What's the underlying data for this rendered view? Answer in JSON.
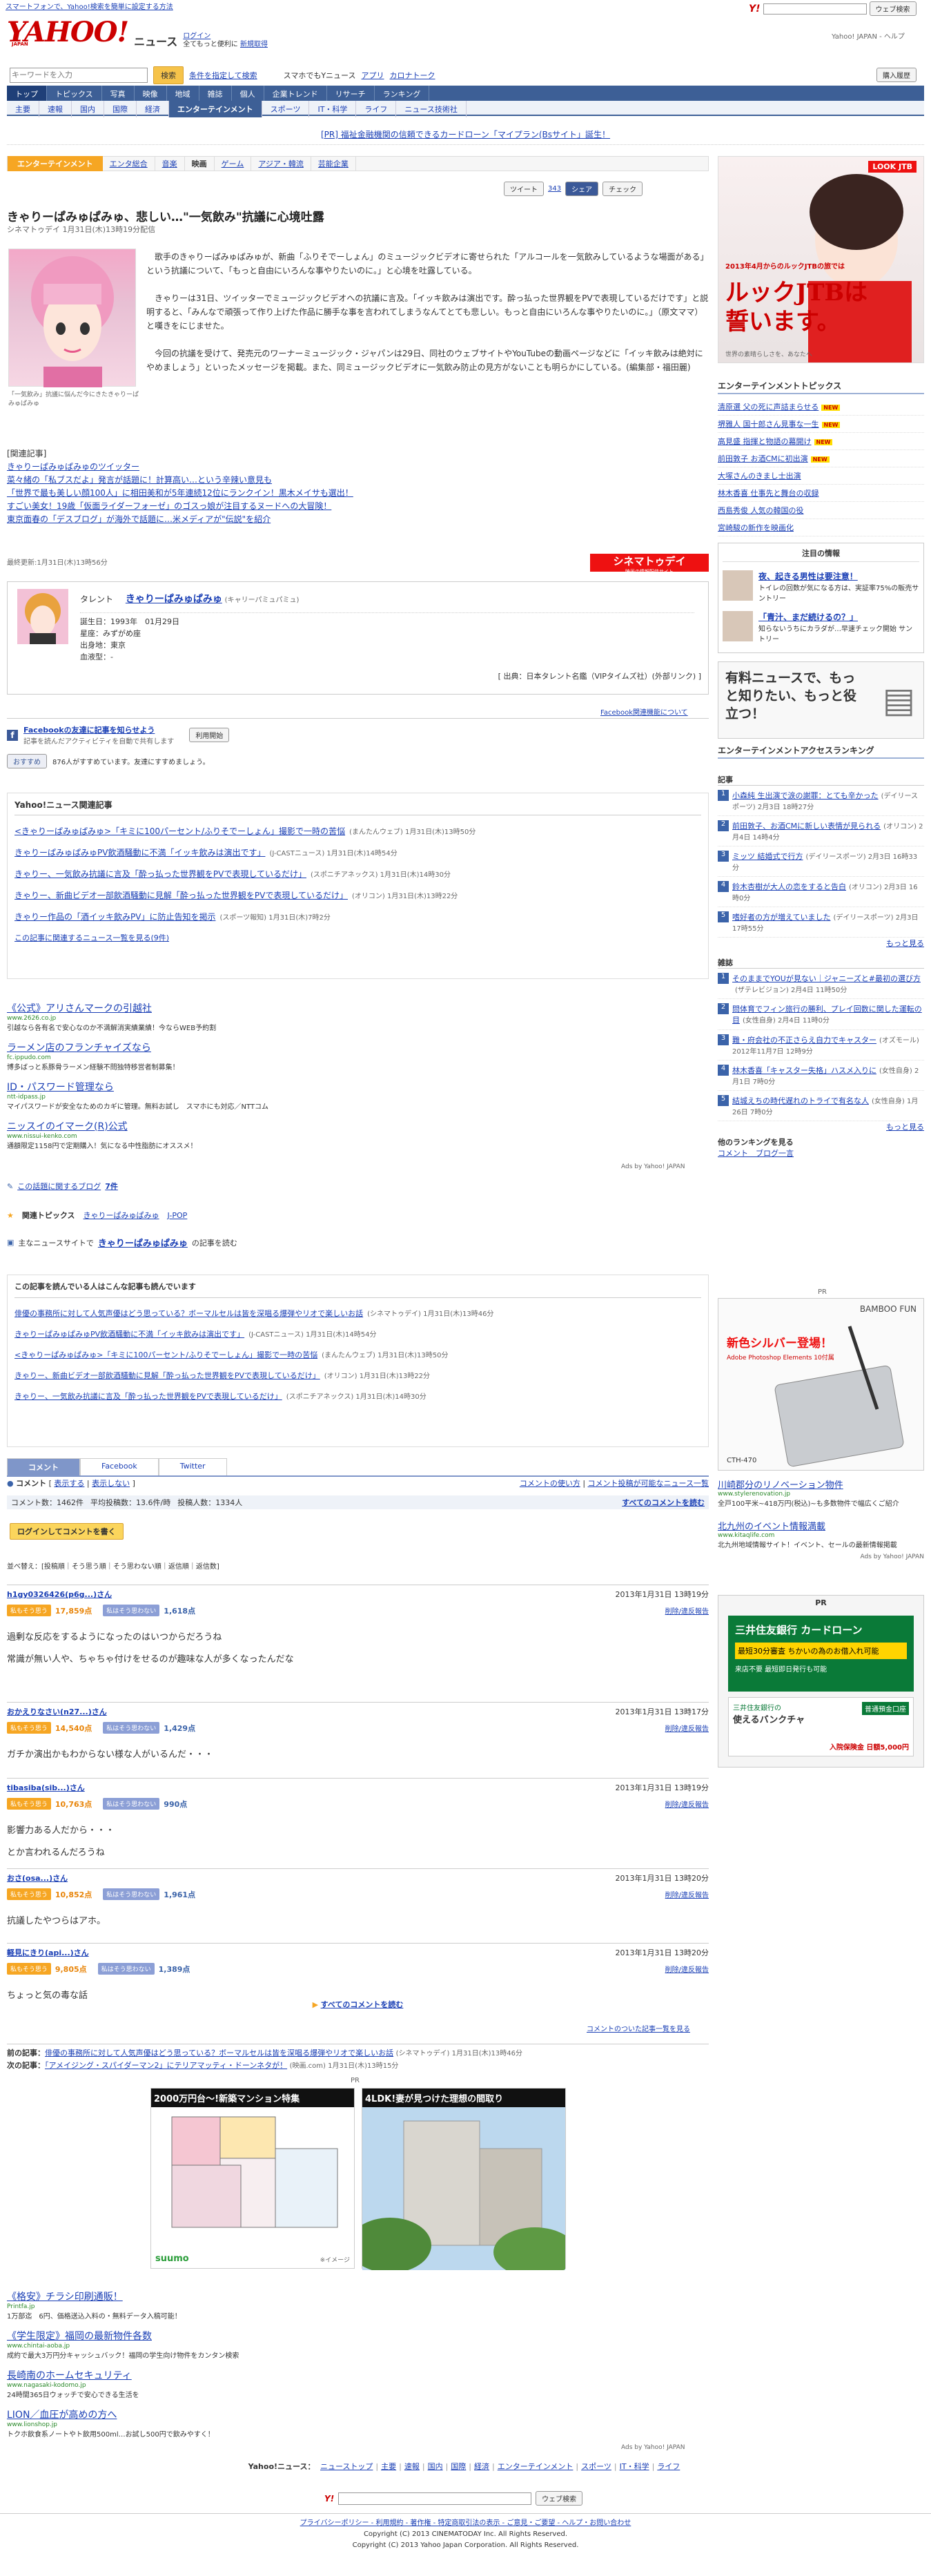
{
  "topbar": {
    "left": "スマートフォンで、Yahoo!検索を簡単に設定する方法",
    "search_btn": "ウェブ検索",
    "links": "Yahoo! JAPAN - ヘルプ"
  },
  "header": {
    "logo": "YAHOO!",
    "logo_sub": "JAPAN",
    "site": "ニュース",
    "login": "ログイン",
    "login_sub": "全てもっと便利に",
    "register": "新規取得",
    "search_placeholder": "キーワードを入力",
    "search_btn": "検索",
    "search_opts": "条件を指定して検索",
    "mobile": "スマホでもYニュース",
    "app": "アプリ",
    "career": "カロナトーク",
    "buy": "購入履歴"
  },
  "tabs": [
    "トップ",
    "トピックス",
    "写真",
    "映像",
    "地域",
    "雑誌",
    "個人",
    "企業トレンド",
    "リサーチ",
    "ランキング"
  ],
  "subnav": [
    "主要",
    "速報",
    "国内",
    "国際",
    "経済",
    "エンターテインメント",
    "スポーツ",
    "IT・科学",
    "ライフ",
    "ニュース技術社"
  ],
  "pr_banner": "[PR] 福祉金融機関の信頼できるカードローン「マイプラン(Bsサイト」誕生！",
  "category": {
    "label": "エンターテインメント",
    "items": [
      "エンタ総合",
      "音楽",
      "映画",
      "ゲーム",
      "アジア・韓流",
      "芸能企業"
    ]
  },
  "article": {
    "title": "きゃりーぱみゅぱみゅ、悲しい…\"一気飲み\"抗議に心境吐露",
    "meta": "シネマトゥデイ 1月31日(木)13時19分配信",
    "tweet": "ツイート",
    "tweet_count": "343",
    "share": "シェア",
    "check": "チェック",
    "photo_caption": "「一気飲み」抗議に悩んだ今にきたきゃりーぱみゅぱみゅ",
    "p1": "歌手のきゃりーぱみゅぱみゅが、新曲「ふりそでーしょん」のミュージックビデオに寄せられた「アルコールを一気飲みしているような場面がある」という抗議について、「もっと自由にいろんな事やりたいのに。」と心境を吐露している。",
    "p2": "きゃりーは31日、ツイッターでミュージックビデオへの抗議に言及。「イッキ飲みは演出です。酔っ払った世界観をPVで表現しているだけです」と説明すると、「みんなで頑張って作り上げた作品に勝手な事を言われてしまうなんてとても悲しい。もっと自由にいろんな事やりたいのに。」（原文ママ）と嘆きをにじませた。",
    "p3": "今回の抗議を受けて、発売元のワーナーミュージック・ジャパンは29日、同社のウェブサイトやYouTubeの動画ページなどに「イッキ飲みは絶対にやめましょう」といったメッセージを掲載。また、同ミュージックビデオに一気飲み防止の見方がないことも明らかにしている。(編集部・福田麗)",
    "related_head": "[関連記事]",
    "related": [
      "きゃりーぱみゅぱみゅのツイッター",
      "菜々緒の「私ブスだよ」発言が話題に！計算高い…という辛辣い意見も",
      "「世界で最も美しい顔100人」に相田美和が5年連続12位にランクイン！黒木メイサも選出！",
      "すごい美女！19歳「仮面ライダーフォーゼ」のゴスっ娘が注目するヌードへの大冒険！",
      "東京面春の「デスブログ」が海外で話題に…米メディアが\"伝説\"を紹介"
    ],
    "updated": "最終更新:1月31日(木)13時56分",
    "cinema_logo": "シネマトゥデイ",
    "cinema_logo_sub": "映画の情報配信サイト"
  },
  "talent": {
    "label": "タレント",
    "name": "きゃりーぱみゅぱみゅ",
    "kana": "(キャリーパミュパミュ)",
    "birth": "誕生日：1993年　01月29日",
    "sign": "星座：みずがめ座",
    "home": "出身地：東京",
    "blood": "血液型：-",
    "source": "[ 出典：日本タレント名鑑（VIPタイムズ社）(外部リンク) ]"
  },
  "fb": {
    "about": "Facebook関連機能について",
    "title": "Facebookの友達に記事を知らせよう",
    "desc": "記事を読んだアクティビティを自動で共有します",
    "start": "利用開始",
    "like_btn": "おすすめ",
    "like_text": "876人がすすめています。友達にすすめましょう。"
  },
  "yrel": {
    "head": "Yahoo!ニュース関連記事",
    "items": [
      {
        "t": "<きゃりーぱみゅぱみゅ>「キミに100パーセント/ふりそでーしょん」撮影で一時の苦悩",
        "s": "(まんたんウェブ) 1月31日(木)13時50分"
      },
      {
        "t": "きゃりーぱみゅぱみゅPV飲酒騒動に不満「イッキ飲みは演出です」",
        "s": "(J-CASTニュース) 1月31日(木)14時54分"
      },
      {
        "t": "きゃりー、一気飲み抗議に言及「酔っ払った世界観をPVで表現しているだけ」",
        "s": "(スポニチアネックス) 1月31日(木)14時30分"
      },
      {
        "t": "きゃりー、新曲ビデオ一部飲酒騒動に見解「酔っ払った世界観をPVで表現しているだけ」",
        "s": "(オリコン) 1月31日(木)13時22分"
      },
      {
        "t": "きゃりー作品の「酒イッキ飲みPV」に防止告知を掲示",
        "s": "(スポーツ報知) 1月31日(木)7時2分"
      }
    ],
    "more": "この記事に関連するニュース一覧を見る(9件)"
  },
  "ads1": [
    {
      "t": "《公式》アリさんマークの引越社",
      "u": "www.2626.co.jp",
      "d": "引越なら各有名で安心なのか不満解消実績業績！今ならWEB予約割"
    },
    {
      "t": "ラーメン店のフランチャイズなら",
      "u": "fc.ippudo.com",
      "d": "博多ばっと系豚骨ラーメン経験不問独特移営者制募集！"
    },
    {
      "t": "ID・パスワード管理なら",
      "u": "ntt-idpass.jp",
      "d": "マイパスワードが安全なためのカギに管理。無料お試し　スマホにも対応／NTTコム"
    },
    {
      "t": "ニッスイのイマーク(R)公式",
      "u": "www.nissui-kenko.com",
      "d": "通額限定1158円で定期購入！気になる中性脂肪にオススメ！"
    }
  ],
  "ads_by": "Ads by Yahoo! JAPAN",
  "blog": {
    "label": "この話題に関するブログ",
    "count": "7件"
  },
  "topics": {
    "label": "関連トピックス",
    "items": [
      "きゃりーぱみゅぱみゅ",
      "J-POP"
    ]
  },
  "mainsite": {
    "label": "主なニュースサイトで",
    "name": "きゃりーぱみゅぱみゅ",
    "suffix": "の記事を読む"
  },
  "alsoread": {
    "head": "この記事を読んでいる人はこんな記事も読んでいます",
    "items": [
      {
        "t": "俳優の事務所に対して人気声優はどう思っている？ボーマルセルは皆を深唱る爆弾やリオで楽しいお話",
        "s": "(シネマトゥデイ) 1月31日(木)13時46分"
      },
      {
        "t": "きゃりーぱみゅぱみゅPV飲酒騒動に不満「イッキ飲みは演出です」",
        "s": "(J-CASTニュース) 1月31日(木)14時54分"
      },
      {
        "t": "<きゃりーぱみゅぱみゅ>「キミに100パーセント/ふりそでーしょん」撮影で一時の苦悩",
        "s": "(まんたんウェブ) 1月31日(木)13時50分"
      },
      {
        "t": "きゃりー、新曲ビデオ一部飲酒騒動に見解「酔っ払った世界観をPVで表現しているだけ」",
        "s": "(オリコン) 1月31日(木)13時22分"
      },
      {
        "t": "きゃりー、一気飲み抗議に言及「酔っ払った世界観をPVで表現しているだけ」",
        "s": "(スポニチアネックス) 1月31日(木)14時30分"
      }
    ]
  },
  "comments": {
    "tabs": [
      "コメント",
      "Facebook",
      "Twitter"
    ],
    "label": "コメント",
    "show": "表示する",
    "hide": "表示しない",
    "tip": "コメントの使い方",
    "listlink": "コメント投稿が可能なニュース一覧",
    "count": "コメント数：1462件",
    "avg": "平均投稿数：13.6件/時",
    "posters": "投稿人数：1334人",
    "all": "すべてのコメントを読む",
    "login": "ログインしてコメントを書く",
    "sort": "並べ替え：[投稿順｜そう思う順｜そう思わない順｜返信順｜返信数]",
    "list": [
      {
        "user": "h1gy0326426(p6g...)さん",
        "time": "2013年1月31日 13時19分",
        "like": "17,859点",
        "dis": "1,618点",
        "body": "過剰な反応をするようになったのはいつからだろうね\n常識が無い人や、ちゃちゃ付けをせるのが趣味な人が多くなったんだな"
      },
      {
        "user": "おかえりなさい(n27...)さん",
        "time": "2013年1月31日 13時17分",
        "like": "14,540点",
        "dis": "1,429点",
        "body": "ガチか演出かもわからない様な人がいるんだ・・・"
      },
      {
        "user": "tibasiba(sib...)さん",
        "time": "2013年1月31日 13時19分",
        "like": "10,763点",
        "dis": "990点",
        "body": "影響力ある人だから・・・\nとか言われるんだろうね"
      },
      {
        "user": "おさ(osa...)さん",
        "time": "2013年1月31日 13時20分",
        "like": "10,852点",
        "dis": "1,961点",
        "body": "抗議したやつらはアホ。"
      },
      {
        "user": "軽見にきり(api...)さん",
        "time": "2013年1月31日 13時20分",
        "like": "9,805点",
        "dis": "1,389点",
        "body": "ちょっと気の毒な話"
      }
    ],
    "report": "削除/違反報告",
    "like_lbl": "私もそう思う",
    "dis_lbl": "私はそう思わない",
    "all2": "すべてのコメントを読む",
    "ranking": "コメントのついた記事一覧を見る"
  },
  "prevnext": {
    "prev_lbl": "前の記事：",
    "prev": "俳優の事務所に対して人気声優はどう思っている？ボーマルセルは皆を深唱る爆弾やリオで楽しいお話",
    "prev_s": "(シネマトゥデイ) 1月31日(木)13時46分",
    "next_lbl": "次の記事：",
    "next": "「アメイジング・スパイダーマン2」にテリアマッティ・ドーンネタが！",
    "next_s": "(映画.com) 1月31日(木)13時15分"
  },
  "pr_mid": {
    "label": "PR",
    "a": "2000万円台～!新築マンション特集",
    "b": "4LDK!妻が見つけた理想の間取り",
    "suumo": "suumo",
    "suumo_note": "※イメージ"
  },
  "ads2": [
    {
      "t": "《格安》チラシ印刷通販！",
      "u": "Printfa.jp",
      "d": "1万部迄　6円、価格送込入料の・無料データ入稿可能！"
    },
    {
      "t": "《学生限定》福岡の最新物件各数",
      "u": "www.chintai-aoba.jp",
      "d": "成約で最大3万円分キャッシュバック！福岡の学生向け物件をカンタン検索"
    },
    {
      "t": "長崎南のホームセキュリティ",
      "u": "www.nagasaki-kodomo.jp",
      "d": "24時間365日ウォッチで安心できる生活を"
    },
    {
      "t": "LION／血圧が高めの方へ",
      "u": "www.lionshop.jp",
      "d": "トクホ飲食系ノートやト飲用500ml…お試し500円で飲みやすく！"
    }
  ],
  "footnav": {
    "label": "Yahoo!ニュース：",
    "items": [
      "ニューストップ",
      "主要",
      "速報",
      "国内",
      "国際",
      "経済",
      "エンターテインメント",
      "スポーツ",
      "IT・科学",
      "ライフ"
    ]
  },
  "footsearch_btn": "ウェブ検索",
  "footer": {
    "links": "プライバシーポリシー - 利用規約 - 著作権 - 特定商取引法の表示 - ご意見・ご要望 - ヘルプ・お問い合わせ",
    "copy1": "Copyright (C) 2013 CINEMATODAY Inc. All Rights Reserved.",
    "copy2": "Copyright (C) 2013 Yahoo Japan Corporation. All Rights Reserved."
  },
  "side": {
    "ad_text": "ルックJTBは誓います。",
    "ad_small": "2013年4月からのルックJTBの旅では",
    "ad_logo": "LOOK JTB",
    "ad_tagline": "世界の素晴らしさを、あなたへ",
    "ent_head": "エンターテインメントトピックス",
    "ent": [
      "清原選 父の死に声詰まらせる",
      "堺雅人 国十郎さん見事な一生",
      "高見盛 指揮と物語の幕開け",
      "前田敦子 お酒CMに初出演",
      "大塚さんのきまし士出演",
      "林木香喜 仕事先と舞台の収録",
      "西島秀俊 人気の韓国の役",
      "宮崎駿の新作を映画化"
    ],
    "notice_head": "注目の情報",
    "notice": [
      {
        "t": "夜、起きる男性は要注意！",
        "d": "トイレの回数が気になる方は、実証率75%の販売サントリー"
      },
      {
        "t": "「青汁、まだ続けるの？」",
        "d": "知らないうちにカラダが…早速チェック開始 サントリー"
      }
    ],
    "yuryo": "有料ニュースで、もっと知りたい、もっと役立つ！",
    "ranking_head": "エンターテインメントアクセスランキング",
    "rank_sub": "記事",
    "ranking": [
      {
        "t": "小森純 生出演で涙の謝罪：とても辛かった",
        "s": "(デイリースポーツ) 2月3日 18時27分"
      },
      {
        "t": "前田敦子、お酒CMに新しい表情が見られる",
        "s": "(オリコン) 2月4日 14時4分"
      },
      {
        "t": "ミッツ 結婚式で行方",
        "s": "(デイリースポーツ) 2月3日 16時33分"
      },
      {
        "t": "鈴木杏樹が大人の恋をすると告白",
        "s": "(オリコン) 2月3日 16時0分"
      },
      {
        "t": "嗜好者の方が増えていました",
        "s": "(デイリースポーツ) 2月3日 17時55分"
      }
    ],
    "more": "もっと見る",
    "mag_head": "雑誌",
    "mag": [
      {
        "t": "そのままでYOUが見ない｜ジャニーズと#最初の選び方",
        "s": "(ザテレビジョン) 2月4日 11時50分"
      },
      {
        "t": "問体育でフィン旅行の勝利、プレイ回数に関した運転の目",
        "s": "(女性自身) 2月4日 11時0分"
      },
      {
        "t": "難・府会社の不正さらえ自力でキャスター",
        "s": "(オズモール) 2012年11月7日 12時9分"
      },
      {
        "t": "林木香喜「キャスター失格」ハスメ入りに",
        "s": "(女性自身) 2月1日 7時0分"
      },
      {
        "t": "結城えちの時代遅れのトライで有名な人",
        "s": "(女性自身) 1月26日 7時0分"
      }
    ],
    "rank_more": "他のランキングを見る",
    "rank_links": "コメント　ブログ一言",
    "pr": "PR",
    "wacom_brand": "BAMBOO FUN",
    "wacom_text": "新色シルバー登場！",
    "wacom_sub": "Adobe Photoshop Elements 10付属",
    "wacom_model": "CTH-470",
    "tx1": {
      "t": "川崎郡分のリノベーション物件",
      "u": "www.stylerenovation.jp",
      "d": "全戸100平米~418万円(税込)~も多数物件で幅広くご紹介"
    },
    "tx2": {
      "t": "北九州のイベント情報満載",
      "u": "www.kitaqlife.com",
      "d": "北九州地域情報サイト！イベント、セールの最新情報掲載"
    },
    "smbc_t": "三井住友銀行 カードローン",
    "smbc_s": "最短30分審査 ちかいの為のお借入れ可能",
    "smbc_pr": "来店不要 最短即日発行も可能",
    "smbc_tag": "三井住友銀行の",
    "smbc2": "使えるバンクチャ",
    "smbc2_note": "入院保険金 日額5,000円",
    "smbc2_badge": "普通預金口座",
    "foot_ads": "Ads by Yahoo! JAPAN"
  }
}
